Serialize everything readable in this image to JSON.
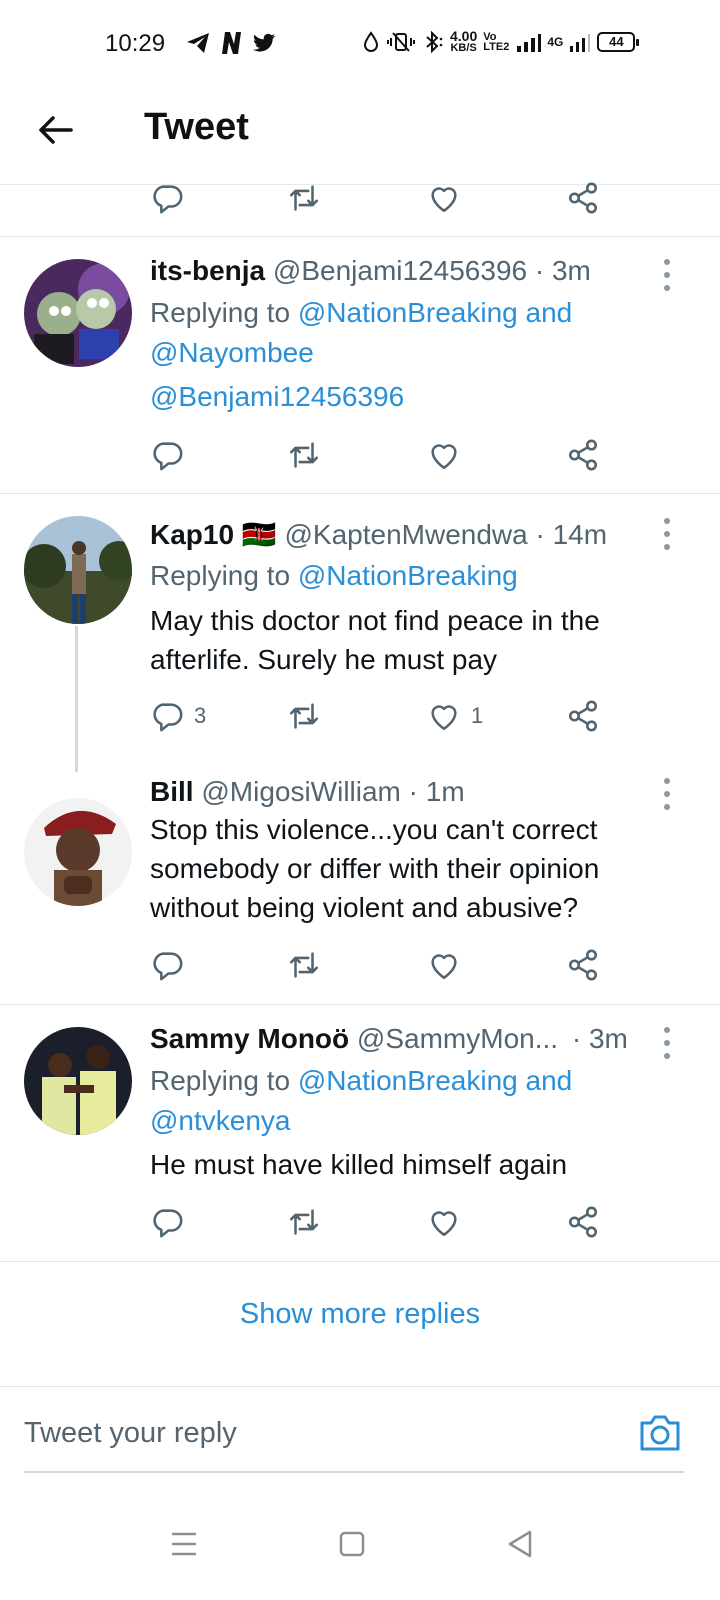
{
  "status_bar": {
    "time": "10:29",
    "net_speed_value": "4.00",
    "net_speed_unit": "KB/S",
    "volte_top": "Vo",
    "volte_bottom": "LTE2",
    "network_type": "4G",
    "battery": "44"
  },
  "header": {
    "title": "Tweet"
  },
  "tweets": [
    {
      "name": "its-benja",
      "handle": "@Benjami12456396",
      "time": "· 3m",
      "replying_prefix": "Replying to ",
      "replying_links": "@NationBreaking and",
      "replying_links2": "@Nayombee",
      "body_link": "@Benjami12456396",
      "replies": "",
      "likes": ""
    },
    {
      "name": "Kap10",
      "flag": "🇰🇪",
      "handle": "@KaptenMwendwa",
      "time": "· 14m",
      "replying_prefix": "Replying to ",
      "replying_links": "@NationBreaking",
      "body": "May this doctor not find peace in the afterlife. Surely he must pay",
      "replies": "3",
      "likes": "1"
    },
    {
      "name": "Bill",
      "handle": "@MigosiWilliam",
      "time": "· 1m",
      "body": "Stop this violence...you can't correct somebody or differ with their opinion without being violent and abusive?",
      "replies": "",
      "likes": ""
    },
    {
      "name": "Sammy Monoö",
      "handle": "@SammyMon...",
      "time": "· 3m",
      "replying_prefix": "Replying to ",
      "replying_links": "@NationBreaking and",
      "replying_links2": "@ntvkenya",
      "body": "He must have killed himself again",
      "replies": "",
      "likes": ""
    }
  ],
  "show_more": "Show more replies",
  "composer": {
    "placeholder": "Tweet your reply"
  },
  "colors": {
    "link": "#2a8fd6",
    "secondary": "#536471",
    "divider": "#e1e5e8"
  }
}
